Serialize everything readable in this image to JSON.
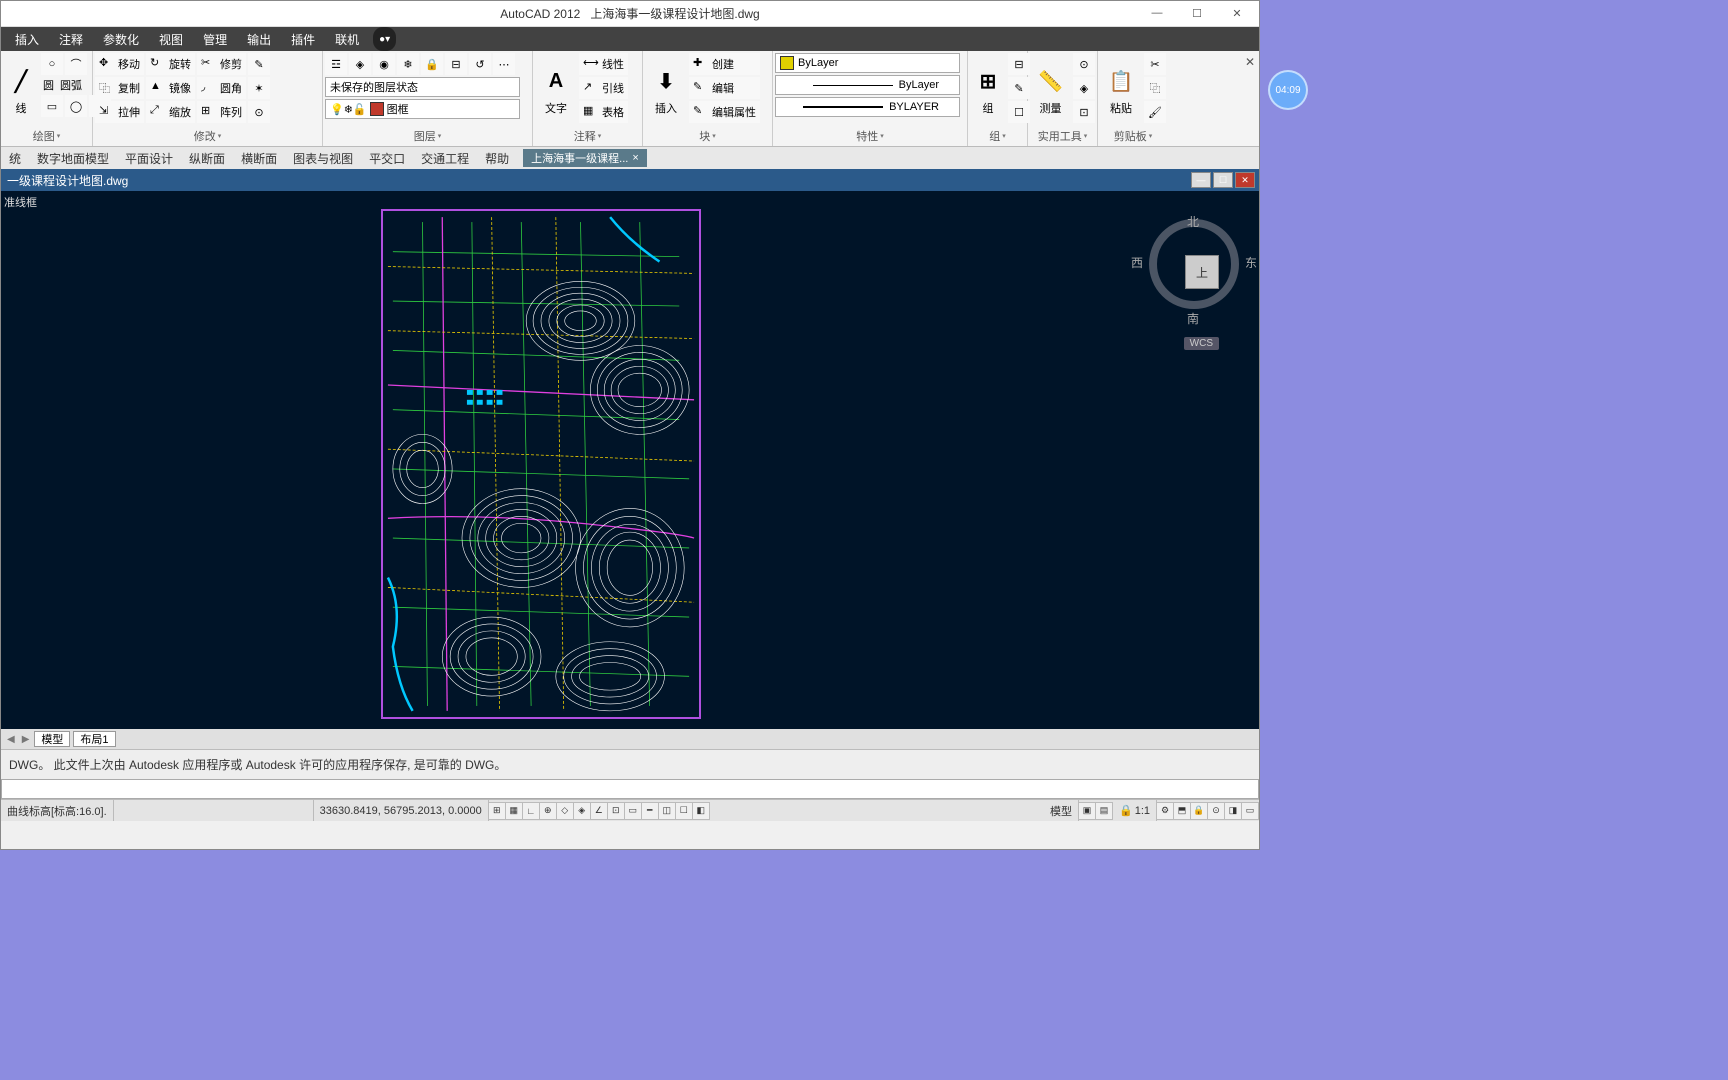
{
  "title": {
    "app": "AutoCAD 2012",
    "file": "上海海事一级课程设计地图.dwg"
  },
  "winctrl": {
    "min": "—",
    "max": "☐",
    "close": "✕"
  },
  "menu": [
    "插入",
    "注释",
    "参数化",
    "视图",
    "管理",
    "输出",
    "插件",
    "联机"
  ],
  "ribbon": {
    "draw": {
      "label": "绘图",
      "items": [
        "线",
        "圆",
        "圆弧"
      ]
    },
    "modify": {
      "label": "修改",
      "items": [
        "移动",
        "复制",
        "拉伸",
        "旋转",
        "镜像",
        "缩放",
        "修剪",
        "圆角",
        "阵列"
      ]
    },
    "layers": {
      "label": "图层",
      "state": "未保存的图层状态",
      "cur": "图框"
    },
    "annot": {
      "label": "注释",
      "text": "文字",
      "items": [
        "线性",
        "引线",
        "表格"
      ]
    },
    "block": {
      "label": "块",
      "insert": "插入",
      "items": [
        "创建",
        "编辑",
        "编辑属性"
      ]
    },
    "props": {
      "label": "特性",
      "bylayer": "ByLayer",
      "bylayer2": "ByLayer",
      "bylayer3": "BYLAYER"
    },
    "group": {
      "label": "组",
      "btn": "组"
    },
    "util": {
      "label": "实用工具",
      "btn": "测量"
    },
    "clip": {
      "label": "剪贴板",
      "btn": "粘贴"
    }
  },
  "secondmenu": [
    "统",
    "数字地面模型",
    "平面设计",
    "纵断面",
    "横断面",
    "图表与视图",
    "平交口",
    "交通工程",
    "帮助"
  ],
  "filetab": "上海海事一级课程...",
  "doc": {
    "title": "一级课程设计地图.dwg",
    "frametxt": "准线框"
  },
  "viewcube": {
    "top": "上",
    "n": "北",
    "s": "南",
    "e": "东",
    "w": "西",
    "wcs": "WCS"
  },
  "tabs": {
    "model": "模型",
    "layout": "布局1"
  },
  "cmd": {
    "msg": "DWG。  此文件上次由 Autodesk 应用程序或 Autodesk 许可的应用程序保存, 是可靠的 DWG。"
  },
  "status": {
    "curve": "曲线标高[标高:16.0].",
    "coords": "33630.8419, 56795.2013, 0.0000",
    "model": "模型",
    "scale": "1:1"
  },
  "clock": "04:09"
}
